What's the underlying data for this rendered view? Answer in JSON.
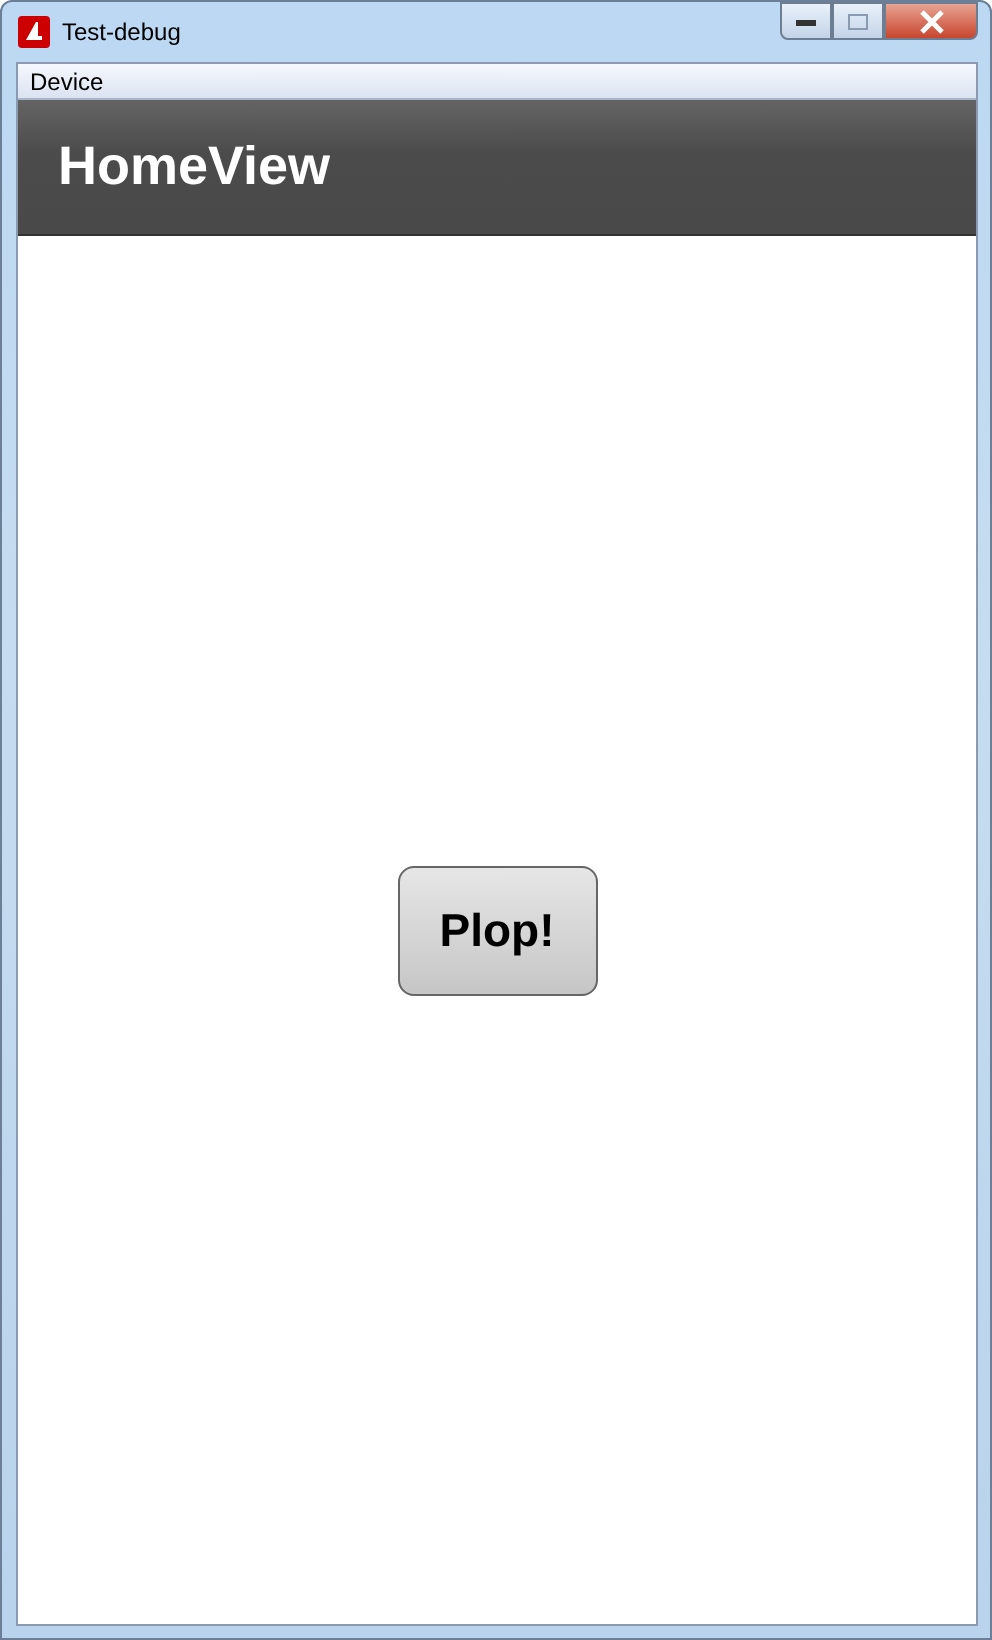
{
  "window": {
    "title": "Test-debug"
  },
  "menu": [
    "Device"
  ],
  "header": {
    "title": "HomeView"
  },
  "button": {
    "label": "Plop!"
  }
}
